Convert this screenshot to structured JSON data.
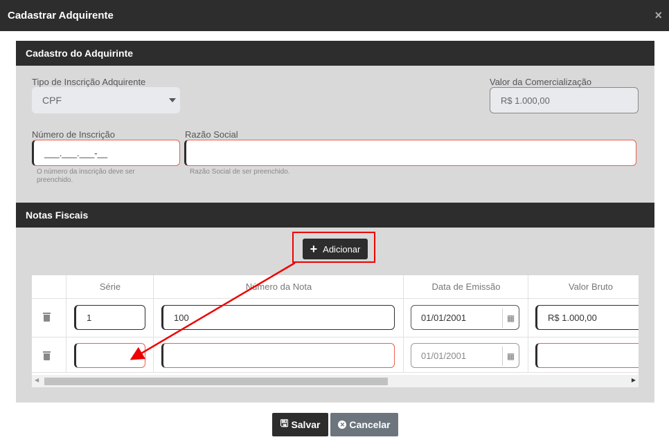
{
  "modal": {
    "title": "Cadastrar Adquirente",
    "close": "×"
  },
  "cadastro": {
    "header": "Cadastro do Adquirinte",
    "tipo_label": "Tipo de Inscrição Adquirente",
    "tipo_value": "CPF",
    "valor_label": "Valor da Comercialização",
    "valor_value": "R$ 1.000,00",
    "numero_label": "Número de Inscrição",
    "numero_value": "___.___.___-__",
    "numero_error": "O número da inscrição deve ser preenchido.",
    "razao_label": "Razão Social",
    "razao_value": "",
    "razao_error": "Razão Social de ser preenchido."
  },
  "notas": {
    "header": "Notas Fiscais",
    "add_label": "Adicionar",
    "columns": [
      "Série",
      "Número da Nota",
      "Data de Emissão",
      "Valor Bruto"
    ],
    "rows": [
      {
        "serie": "1",
        "numero": "100",
        "data": "01/01/2001",
        "valor": "R$ 1.000,00"
      },
      {
        "serie": "",
        "numero": "",
        "data": "01/01/2001",
        "valor": ""
      }
    ]
  },
  "footer": {
    "save": "Salvar",
    "cancel": "Cancelar"
  },
  "colors": {
    "dark": "#2d2d2d",
    "error": "#e8604c",
    "annotation": "#e00000",
    "cancel": "#6c757d"
  }
}
